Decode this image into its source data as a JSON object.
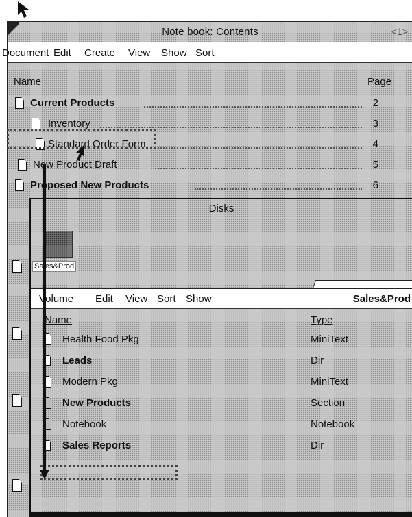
{
  "notebook": {
    "title": "Note book: Contents",
    "page_indicator": "<1>",
    "menu": [
      "Document",
      "Edit",
      "Create",
      "View",
      "Show",
      "Sort"
    ],
    "headers": {
      "name": "Name",
      "page": "Page"
    },
    "rows": [
      {
        "label": "Current Products",
        "page": "2",
        "bold": true
      },
      {
        "label": "Inventory",
        "page": "3",
        "bold": false
      },
      {
        "label": "Standard Order Form",
        "page": "4",
        "bold": false
      },
      {
        "label": "New Product Draft",
        "page": "5",
        "bold": false
      },
      {
        "label": "Proposed New Products",
        "page": "6",
        "bold": true
      }
    ]
  },
  "disks": {
    "title": "Disks",
    "disk_label": "Sales&Prod"
  },
  "volume": {
    "menu": [
      "Volume",
      "Edit",
      "View",
      "Sort",
      "Show"
    ],
    "name": "Sales&Prod",
    "headers": {
      "name": "Name",
      "type": "Type"
    },
    "items": [
      {
        "label": "Health Food Pkg",
        "type": "MiniText",
        "bold": false
      },
      {
        "label": "Leads",
        "type": "Dir",
        "bold": true
      },
      {
        "label": "Modern Pkg",
        "type": "MiniText",
        "bold": false
      },
      {
        "label": "New Products",
        "type": "Section",
        "bold": true
      },
      {
        "label": "Notebook",
        "type": "Notebook",
        "bold": false
      },
      {
        "label": "Sales Reports",
        "type": "Dir",
        "bold": true
      }
    ]
  }
}
